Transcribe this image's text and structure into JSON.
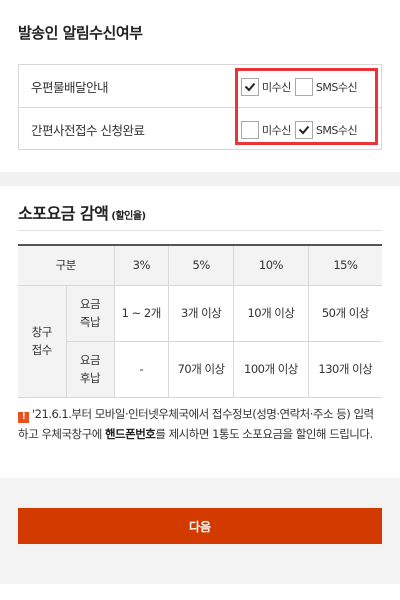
{
  "notify": {
    "title": "발송인 알림수신여부",
    "rows": [
      {
        "label": "우편물배달안내",
        "opt1_checked": true,
        "opt1_label": "미수신",
        "opt2_checked": false,
        "opt2_label": "SMS수신"
      },
      {
        "label": "간편사전접수 신청완료",
        "opt1_checked": false,
        "opt1_label": "미수신",
        "opt2_checked": true,
        "opt2_label": "SMS수신"
      }
    ],
    "highlight_color": "#e8343a"
  },
  "discount": {
    "title": "소포요금 감액",
    "subtitle": "(할인율)",
    "table": {
      "header": [
        "구분",
        "3%",
        "5%",
        "10%",
        "15%"
      ],
      "group_label": "창구\n접수",
      "rows": [
        {
          "label": "요금\n즉납",
          "cells": [
            "1 ~ 2개",
            "3개 이상",
            "10개 이상",
            "50개 이상"
          ]
        },
        {
          "label": "요금\n후납",
          "cells": [
            "-",
            "70개 이상",
            "100개 이상",
            "130개 이상"
          ]
        }
      ]
    },
    "note_icon": "!",
    "note_text_pre": "'21.6.1.부터 모바일·인터넷우체국에서 접수정보(성명·연락처·주소 등) 입력하고 우체국창구에 ",
    "note_text_bold": "핸드폰번호",
    "note_text_post": "를 제시하면 1통도 소포요금을 할인해 드립니다."
  },
  "next_button": {
    "label": "다음",
    "color": "#d23a00"
  }
}
